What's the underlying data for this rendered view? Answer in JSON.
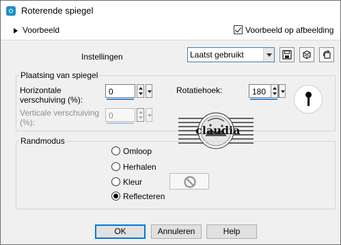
{
  "window": {
    "title": "Roterende spiegel",
    "icon": "app-icon"
  },
  "preview_row": {
    "expand_label": "Voorbeeld",
    "preview_on_image_label": "Voorbeeld op afbeelding",
    "preview_on_image_checked": true
  },
  "settings": {
    "label": "Instellingen",
    "preset_value": "Laatst gebruikt",
    "tool_icons": [
      "save-icon",
      "dice-icon",
      "reset-icon"
    ]
  },
  "mirror_placement": {
    "title": "Plaatsing van spiegel",
    "horizontal_label_line1": "Horizontale",
    "horizontal_label_line2": "verschuiving (%):",
    "horizontal_value": "0",
    "vertical_label_line1": "Verticale verschuiving",
    "vertical_label_line2": "(%):",
    "vertical_value": "0",
    "vertical_disabled": true,
    "rotation_label": "Rotatiehoek:",
    "rotation_value": "180",
    "watermark_text": "claudia"
  },
  "edge_mode": {
    "title": "Randmodus",
    "options": [
      {
        "label": "Omloop",
        "selected": false
      },
      {
        "label": "Herhalen",
        "selected": false
      },
      {
        "label": "Kleur",
        "selected": false
      },
      {
        "label": "Reflecteren",
        "selected": true
      }
    ],
    "color_icon": "no-color-icon"
  },
  "buttons": {
    "ok": "OK",
    "cancel": "Annuleren",
    "help": "Help"
  },
  "colors": {
    "accent": "#3b86d6",
    "default_button_border": "#0078d7",
    "icon_blue": "#1e90c8"
  }
}
